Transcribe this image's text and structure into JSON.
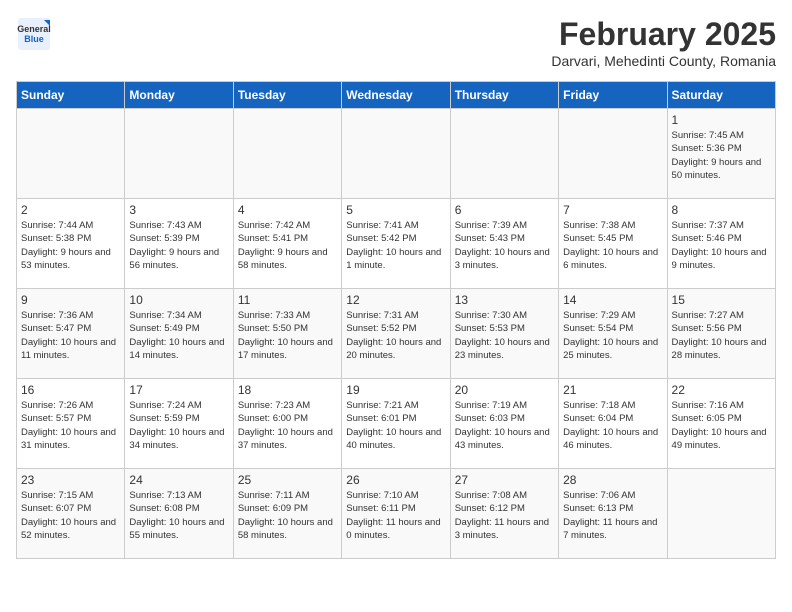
{
  "header": {
    "logo_general": "General",
    "logo_blue": "Blue",
    "title": "February 2025",
    "subtitle": "Darvari, Mehedinti County, Romania"
  },
  "days_of_week": [
    "Sunday",
    "Monday",
    "Tuesday",
    "Wednesday",
    "Thursday",
    "Friday",
    "Saturday"
  ],
  "weeks": [
    {
      "cells": [
        {
          "day": null,
          "text": ""
        },
        {
          "day": null,
          "text": ""
        },
        {
          "day": null,
          "text": ""
        },
        {
          "day": null,
          "text": ""
        },
        {
          "day": null,
          "text": ""
        },
        {
          "day": null,
          "text": ""
        },
        {
          "day": "1",
          "text": "Sunrise: 7:45 AM\nSunset: 5:36 PM\nDaylight: 9 hours and 50 minutes."
        }
      ]
    },
    {
      "cells": [
        {
          "day": "2",
          "text": "Sunrise: 7:44 AM\nSunset: 5:38 PM\nDaylight: 9 hours and 53 minutes."
        },
        {
          "day": "3",
          "text": "Sunrise: 7:43 AM\nSunset: 5:39 PM\nDaylight: 9 hours and 56 minutes."
        },
        {
          "day": "4",
          "text": "Sunrise: 7:42 AM\nSunset: 5:41 PM\nDaylight: 9 hours and 58 minutes."
        },
        {
          "day": "5",
          "text": "Sunrise: 7:41 AM\nSunset: 5:42 PM\nDaylight: 10 hours and 1 minute."
        },
        {
          "day": "6",
          "text": "Sunrise: 7:39 AM\nSunset: 5:43 PM\nDaylight: 10 hours and 3 minutes."
        },
        {
          "day": "7",
          "text": "Sunrise: 7:38 AM\nSunset: 5:45 PM\nDaylight: 10 hours and 6 minutes."
        },
        {
          "day": "8",
          "text": "Sunrise: 7:37 AM\nSunset: 5:46 PM\nDaylight: 10 hours and 9 minutes."
        }
      ]
    },
    {
      "cells": [
        {
          "day": "9",
          "text": "Sunrise: 7:36 AM\nSunset: 5:47 PM\nDaylight: 10 hours and 11 minutes."
        },
        {
          "day": "10",
          "text": "Sunrise: 7:34 AM\nSunset: 5:49 PM\nDaylight: 10 hours and 14 minutes."
        },
        {
          "day": "11",
          "text": "Sunrise: 7:33 AM\nSunset: 5:50 PM\nDaylight: 10 hours and 17 minutes."
        },
        {
          "day": "12",
          "text": "Sunrise: 7:31 AM\nSunset: 5:52 PM\nDaylight: 10 hours and 20 minutes."
        },
        {
          "day": "13",
          "text": "Sunrise: 7:30 AM\nSunset: 5:53 PM\nDaylight: 10 hours and 23 minutes."
        },
        {
          "day": "14",
          "text": "Sunrise: 7:29 AM\nSunset: 5:54 PM\nDaylight: 10 hours and 25 minutes."
        },
        {
          "day": "15",
          "text": "Sunrise: 7:27 AM\nSunset: 5:56 PM\nDaylight: 10 hours and 28 minutes."
        }
      ]
    },
    {
      "cells": [
        {
          "day": "16",
          "text": "Sunrise: 7:26 AM\nSunset: 5:57 PM\nDaylight: 10 hours and 31 minutes."
        },
        {
          "day": "17",
          "text": "Sunrise: 7:24 AM\nSunset: 5:59 PM\nDaylight: 10 hours and 34 minutes."
        },
        {
          "day": "18",
          "text": "Sunrise: 7:23 AM\nSunset: 6:00 PM\nDaylight: 10 hours and 37 minutes."
        },
        {
          "day": "19",
          "text": "Sunrise: 7:21 AM\nSunset: 6:01 PM\nDaylight: 10 hours and 40 minutes."
        },
        {
          "day": "20",
          "text": "Sunrise: 7:19 AM\nSunset: 6:03 PM\nDaylight: 10 hours and 43 minutes."
        },
        {
          "day": "21",
          "text": "Sunrise: 7:18 AM\nSunset: 6:04 PM\nDaylight: 10 hours and 46 minutes."
        },
        {
          "day": "22",
          "text": "Sunrise: 7:16 AM\nSunset: 6:05 PM\nDaylight: 10 hours and 49 minutes."
        }
      ]
    },
    {
      "cells": [
        {
          "day": "23",
          "text": "Sunrise: 7:15 AM\nSunset: 6:07 PM\nDaylight: 10 hours and 52 minutes."
        },
        {
          "day": "24",
          "text": "Sunrise: 7:13 AM\nSunset: 6:08 PM\nDaylight: 10 hours and 55 minutes."
        },
        {
          "day": "25",
          "text": "Sunrise: 7:11 AM\nSunset: 6:09 PM\nDaylight: 10 hours and 58 minutes."
        },
        {
          "day": "26",
          "text": "Sunrise: 7:10 AM\nSunset: 6:11 PM\nDaylight: 11 hours and 0 minutes."
        },
        {
          "day": "27",
          "text": "Sunrise: 7:08 AM\nSunset: 6:12 PM\nDaylight: 11 hours and 3 minutes."
        },
        {
          "day": "28",
          "text": "Sunrise: 7:06 AM\nSunset: 6:13 PM\nDaylight: 11 hours and 7 minutes."
        },
        {
          "day": null,
          "text": ""
        }
      ]
    }
  ]
}
